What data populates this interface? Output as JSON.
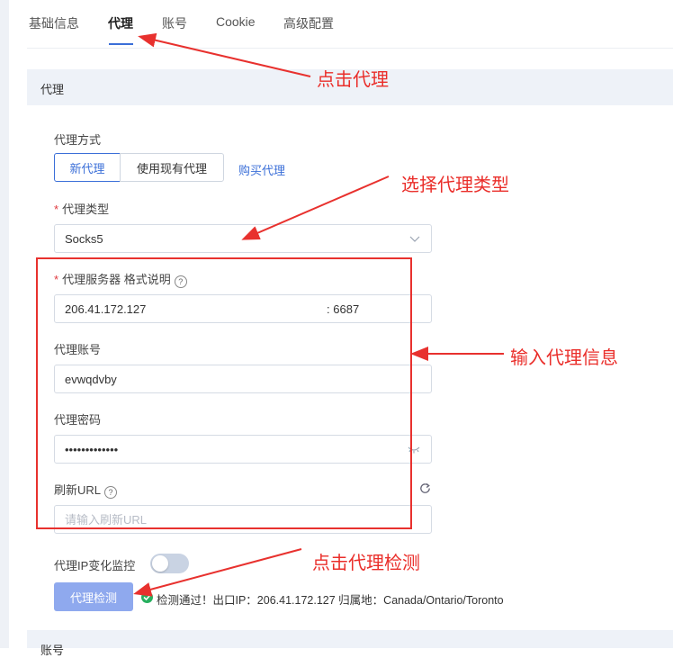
{
  "tabs": [
    {
      "label": "基础信息"
    },
    {
      "label": "代理"
    },
    {
      "label": "账号"
    },
    {
      "label": "Cookie"
    },
    {
      "label": "高级配置"
    }
  ],
  "active_tab": "代理",
  "section": {
    "title": "代理",
    "next_title": "账号"
  },
  "proxy_mode": {
    "label": "代理方式",
    "options": [
      "新代理",
      "使用现有代理"
    ],
    "selected": "新代理",
    "buy_link": "购买代理"
  },
  "proxy_type": {
    "required_mark": "*",
    "label": "代理类型",
    "value": "Socks5"
  },
  "proxy_server": {
    "required_mark": "*",
    "label": "代理服务器",
    "format_label": "格式说明",
    "host": "206.41.172.127",
    "port_prefix": ":",
    "port": "6687"
  },
  "proxy_account": {
    "label": "代理账号",
    "value": "evwqdvby"
  },
  "proxy_password": {
    "label": "代理密码",
    "value": "•••••••••••••"
  },
  "refresh_url": {
    "label": "刷新URL",
    "placeholder": "请输入刷新URL"
  },
  "ip_monitor": {
    "label": "代理IP变化监控",
    "enabled": false
  },
  "check": {
    "button_label": "代理检测",
    "result": "检测通过！出口IP：206.41.172.127 归属地：Canada/Ontario/Toronto",
    "status_color": "#27b05f"
  },
  "annotations": {
    "click_tab": "点击代理",
    "select_type": "选择代理类型",
    "enter_info": "输入代理信息",
    "click_check": "点击代理检测",
    "color": "#ea2e2a"
  },
  "colors": {
    "accent": "#3b6fd8",
    "section_bg": "#eef2f8",
    "check_button": "#8fa9ee"
  }
}
